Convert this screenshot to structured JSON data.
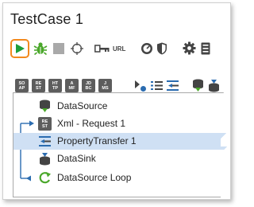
{
  "title": "TestCase 1",
  "toolbar2": {
    "steps": [
      {
        "l1": "SO",
        "l2": "AP"
      },
      {
        "l1": "RE",
        "l2": "ST"
      },
      {
        "l1": "HT",
        "l2": "TP"
      },
      {
        "l1": "A",
        "l2": "MF"
      },
      {
        "l1": "JD",
        "l2": "BC"
      },
      {
        "l1": "J",
        "l2": "MS"
      }
    ]
  },
  "toolbar1": {
    "url_label": "URL"
  },
  "tree": {
    "items": [
      {
        "label": "DataSource"
      },
      {
        "label": "Xml - Request 1",
        "icon_l1": "RE",
        "icon_l2": "ST"
      },
      {
        "label": "PropertyTransfer 1"
      },
      {
        "label": "DataSink"
      },
      {
        "label": "DataSource Loop"
      }
    ]
  },
  "colors": {
    "accent_orange": "#f28a1e",
    "run_green": "#1e9e3a",
    "bug_green": "#4aa72a",
    "selection": "#cfe0f4",
    "icon_gray": "#5d5d5d",
    "blue": "#2b6cb0"
  }
}
